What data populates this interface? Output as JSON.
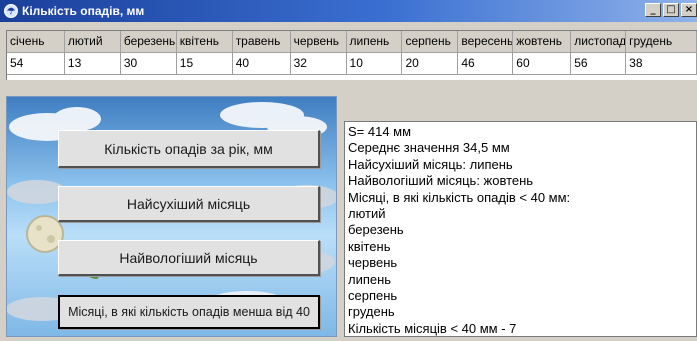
{
  "window": {
    "title": "Кількість опадів, мм",
    "buttons": [
      "_",
      "□",
      "×"
    ]
  },
  "months_table": {
    "columns": [
      "січень",
      "лютий",
      "березень",
      "квітень",
      "травень",
      "червень",
      "липень",
      "серпень",
      "вересень",
      "жовтень",
      "листопад",
      "грудень"
    ],
    "values": [
      "54",
      "13",
      "30",
      "15",
      "40",
      "32",
      "10",
      "20",
      "46",
      "60",
      "56",
      "38"
    ]
  },
  "actions": {
    "total": "Кількість опадів за рік, мм",
    "driest": "Найсухіший місяць",
    "wettest": "Найвологіший місяць",
    "below40": "Місяці, в які кількість опадів менша від 40"
  },
  "output": {
    "lines": [
      "S= 414 мм",
      "Середнє значення 34,5 мм",
      "Найсухіший місяць: липень",
      "Найвологіший місяць: жовтень",
      "Місяці, в які кількість опадів < 40 мм:",
      "лютий",
      "березень",
      "квітень",
      "червень",
      "липень",
      "серпень",
      "грудень",
      "Кількість місяців < 40 мм -  7"
    ]
  }
}
